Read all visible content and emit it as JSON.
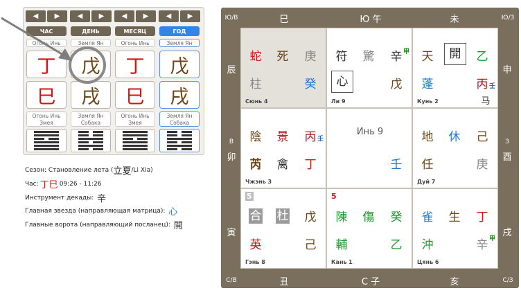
{
  "calendar": {
    "arrows": [
      "◀",
      "▶"
    ],
    "columns": [
      {
        "tab": "ЧАС",
        "active": false,
        "top_element": "Огонь Инь",
        "stem": "丁",
        "branch": "巳",
        "bottom_element": [
          "Огонь Инь",
          "Змея"
        ]
      },
      {
        "tab": "ДЕНЬ",
        "active": false,
        "top_element": "Земля Ян",
        "stem": "戊",
        "branch": "戌",
        "bottom_element": [
          "Земля Ян",
          "Собака"
        ]
      },
      {
        "tab": "МЕСЯЦ",
        "active": false,
        "top_element": "Огонь Инь",
        "stem": "丁",
        "branch": "巳",
        "bottom_element": [
          "Огонь Инь",
          "Змея"
        ]
      },
      {
        "tab": "ГОД",
        "active": true,
        "top_element": "Земля Ян",
        "stem": "戊",
        "branch": "戌",
        "bottom_element": [
          "Земля Ян",
          "Собака"
        ]
      }
    ]
  },
  "info": {
    "season_label": "Сезон:",
    "season_value": "Становление лета (",
    "season_hz": "立夏",
    "season_tail": "/Li Xia)",
    "hour_label": "Час:",
    "hour_hz": "丁巳",
    "hour_time": "09:26 - 11:26",
    "decade_label": "Инструмент декады:",
    "decade_hz": "辛",
    "star_label": "Главная звезда (направляющая матрица):",
    "star_hz": "心",
    "gate_label": "Главные ворота (направляющий посланец):",
    "gate_hz": "開"
  },
  "board": {
    "corners": {
      "nw": "Ю/В",
      "ne": "Ю/З",
      "sw": "С/В",
      "se": "С/З"
    },
    "top": [
      "巳",
      "Ю 午",
      "未"
    ],
    "bottom": [
      "丑",
      "С 子",
      "亥"
    ],
    "left": [
      "辰",
      "В",
      "卯",
      "寅"
    ],
    "right": [
      "申",
      "З",
      "酉",
      "戌"
    ],
    "cells": {
      "xun4": {
        "name": "Сюнь 4",
        "g": [
          "蛇",
          "死",
          "庚",
          "柱",
          "癸"
        ]
      },
      "li9": {
        "name": "Ли 9",
        "g": [
          "符",
          "驚",
          "辛",
          "心",
          "戊"
        ],
        "sup": "甲"
      },
      "kun2": {
        "name": "Кунь 2",
        "g": [
          "天",
          "開",
          "乙",
          "蓬",
          "丙"
        ],
        "sup": "壬",
        "extra": "马"
      },
      "zhen3": {
        "name": "Чжэнь 3",
        "g": [
          "陰",
          "景",
          "丙",
          "芮",
          "禽",
          "丁"
        ],
        "sup": "壬"
      },
      "center": {
        "title": "Инь 9",
        "g": [
          "壬"
        ]
      },
      "dui7": {
        "name": "Дуй 7",
        "g": [
          "地",
          "休",
          "己",
          "任",
          "庚"
        ]
      },
      "gen8": {
        "name": "Гэнь 8",
        "num": "5",
        "g": [
          "合",
          "杜",
          "戊",
          "英",
          "己"
        ]
      },
      "kan1": {
        "name": "Кань 1",
        "num": "5",
        "g": [
          "陳",
          "傷",
          "癸",
          "輔",
          "乙"
        ]
      },
      "qian6": {
        "name": "Цянь 6",
        "g": [
          "雀",
          "生",
          "丁",
          "沖",
          "辛"
        ],
        "sup": "甲"
      }
    }
  }
}
